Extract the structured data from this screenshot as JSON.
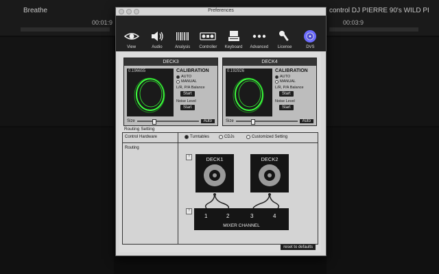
{
  "background_app": {
    "left_track": "Breathe",
    "left_time": "00:01:9",
    "right_track": "control DJ PIERRE 90's WILD PI",
    "right_time": "00:03:9"
  },
  "window": {
    "title": "Preferences"
  },
  "toolbar": [
    {
      "label": "View",
      "icon": "eye-icon"
    },
    {
      "label": "Audio",
      "icon": "speaker-icon"
    },
    {
      "label": "Analysis",
      "icon": "barcode-icon"
    },
    {
      "label": "Controller",
      "icon": "controller-icon"
    },
    {
      "label": "Keyboard",
      "icon": "keyboard-icon"
    },
    {
      "label": "Advanced",
      "icon": "dots-icon"
    },
    {
      "label": "License",
      "icon": "key-icon"
    },
    {
      "label": "DVS",
      "icon": "disc-icon"
    }
  ],
  "deck3": {
    "title": "DECK3",
    "value": "0.196655"
  },
  "deck4": {
    "title": "DECK4",
    "value": "0.192926"
  },
  "calibration": {
    "heading": "CALIBRATION",
    "auto": "AUTO",
    "manual": "MANUAL",
    "balance": "L/R, P/A Balance",
    "start": "Start",
    "noise": "Noise Level",
    "size": "Size",
    "auto_btn": "Auto"
  },
  "routing": {
    "section_title": "Routing Setting",
    "control_hardware": "Control Hardware",
    "opt_turntables": "Turntables",
    "opt_cdjs": "CDJs",
    "opt_custom": "Customized Setting",
    "routing_label": "Routing",
    "deck1": "DECK1",
    "deck2": "DECK2",
    "ch1": "1",
    "ch2": "2",
    "ch3": "3",
    "ch4": "4",
    "mixer_title": "MIXER CHANNEL",
    "help": "?"
  },
  "reset_label": "reset to defaults",
  "colors": {
    "scope_trace": "#3dff3d",
    "accent_dvs": "#6c6cff"
  }
}
